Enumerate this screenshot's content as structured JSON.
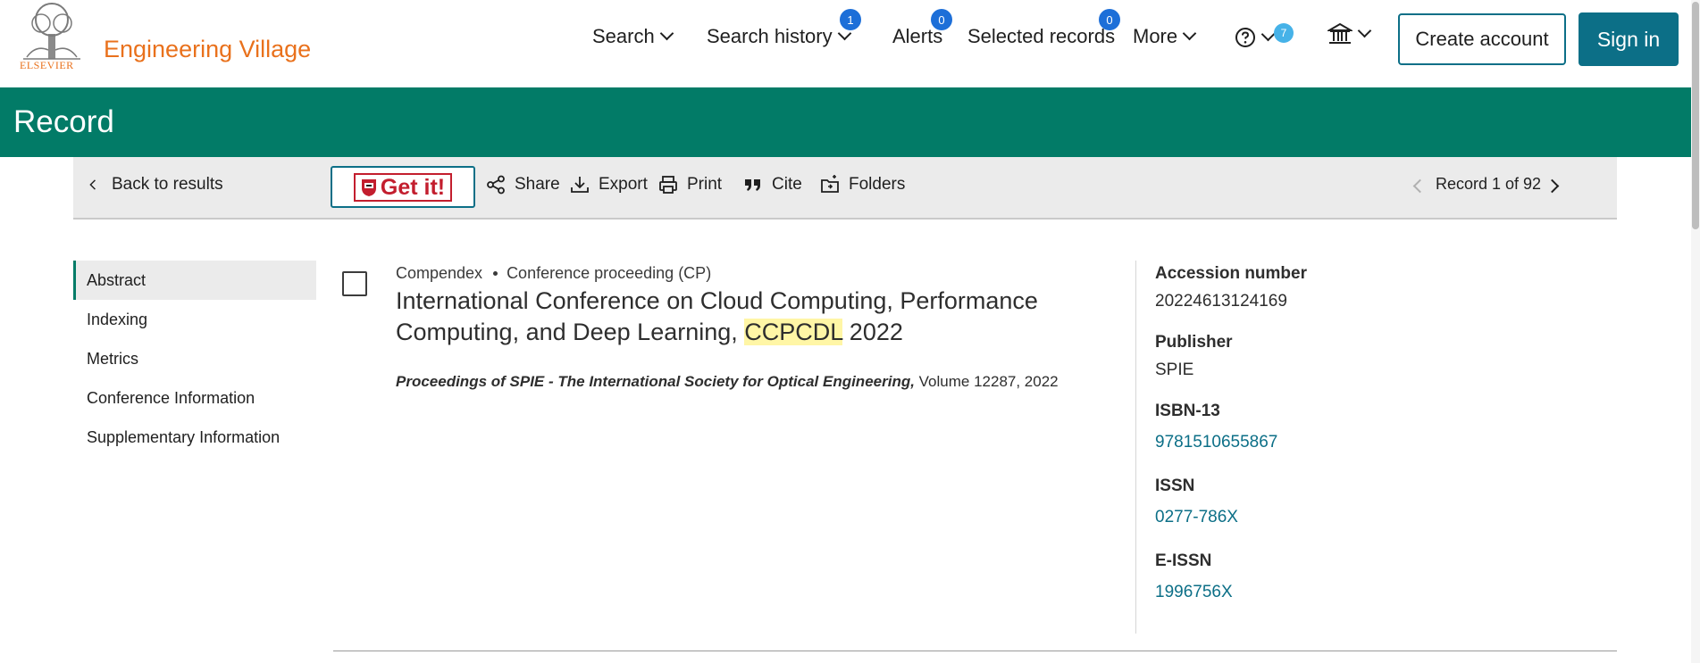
{
  "header": {
    "logo_text": "ELSEVIER",
    "brand": "Engineering Village",
    "nav": {
      "search": "Search",
      "search_history": "Search history",
      "search_history_count": "1",
      "alerts": "Alerts",
      "alerts_count": "0",
      "selected_records": "Selected records",
      "selected_records_count": "0",
      "more": "More",
      "help_count": "7"
    },
    "create_account": "Create account",
    "sign_in": "Sign in"
  },
  "page_title": "Record",
  "toolbar": {
    "back": "Back to results",
    "get_it": "Get it!",
    "share": "Share",
    "export": "Export",
    "print": "Print",
    "cite": "Cite",
    "folders": "Folders",
    "pager": "Record 1 of 92"
  },
  "sidebar": {
    "items": [
      {
        "label": "Abstract",
        "active": true
      },
      {
        "label": "Indexing"
      },
      {
        "label": "Metrics"
      },
      {
        "label": "Conference Information"
      },
      {
        "label": "Supplementary Information"
      }
    ]
  },
  "record": {
    "database": "Compendex",
    "doc_type": "Conference proceeding (CP)",
    "title_before": "International Conference on Cloud Computing, Performance Computing, and Deep Learning, ",
    "title_highlight": "CCPCDL",
    "title_after": " 2022",
    "journal": "Proceedings of SPIE - The International Society for Optical Engineering,",
    "volume_year": " Volume 12287, 2022"
  },
  "details": {
    "accession_label": "Accession number",
    "accession_value": "20224613124169",
    "publisher_label": "Publisher",
    "publisher_value": "SPIE",
    "isbn_label": "ISBN-13",
    "isbn_value": "9781510655867",
    "issn_label": "ISSN",
    "issn_value": "0277-786X",
    "eissn_label": "E-ISSN",
    "eissn_value": "1996756X"
  },
  "colors": {
    "brand_orange": "#e9711c",
    "record_band": "#027b67",
    "link_teal": "#0c6f87",
    "badge_blue": "#1d6fd8",
    "highlight": "#fff6a6"
  }
}
